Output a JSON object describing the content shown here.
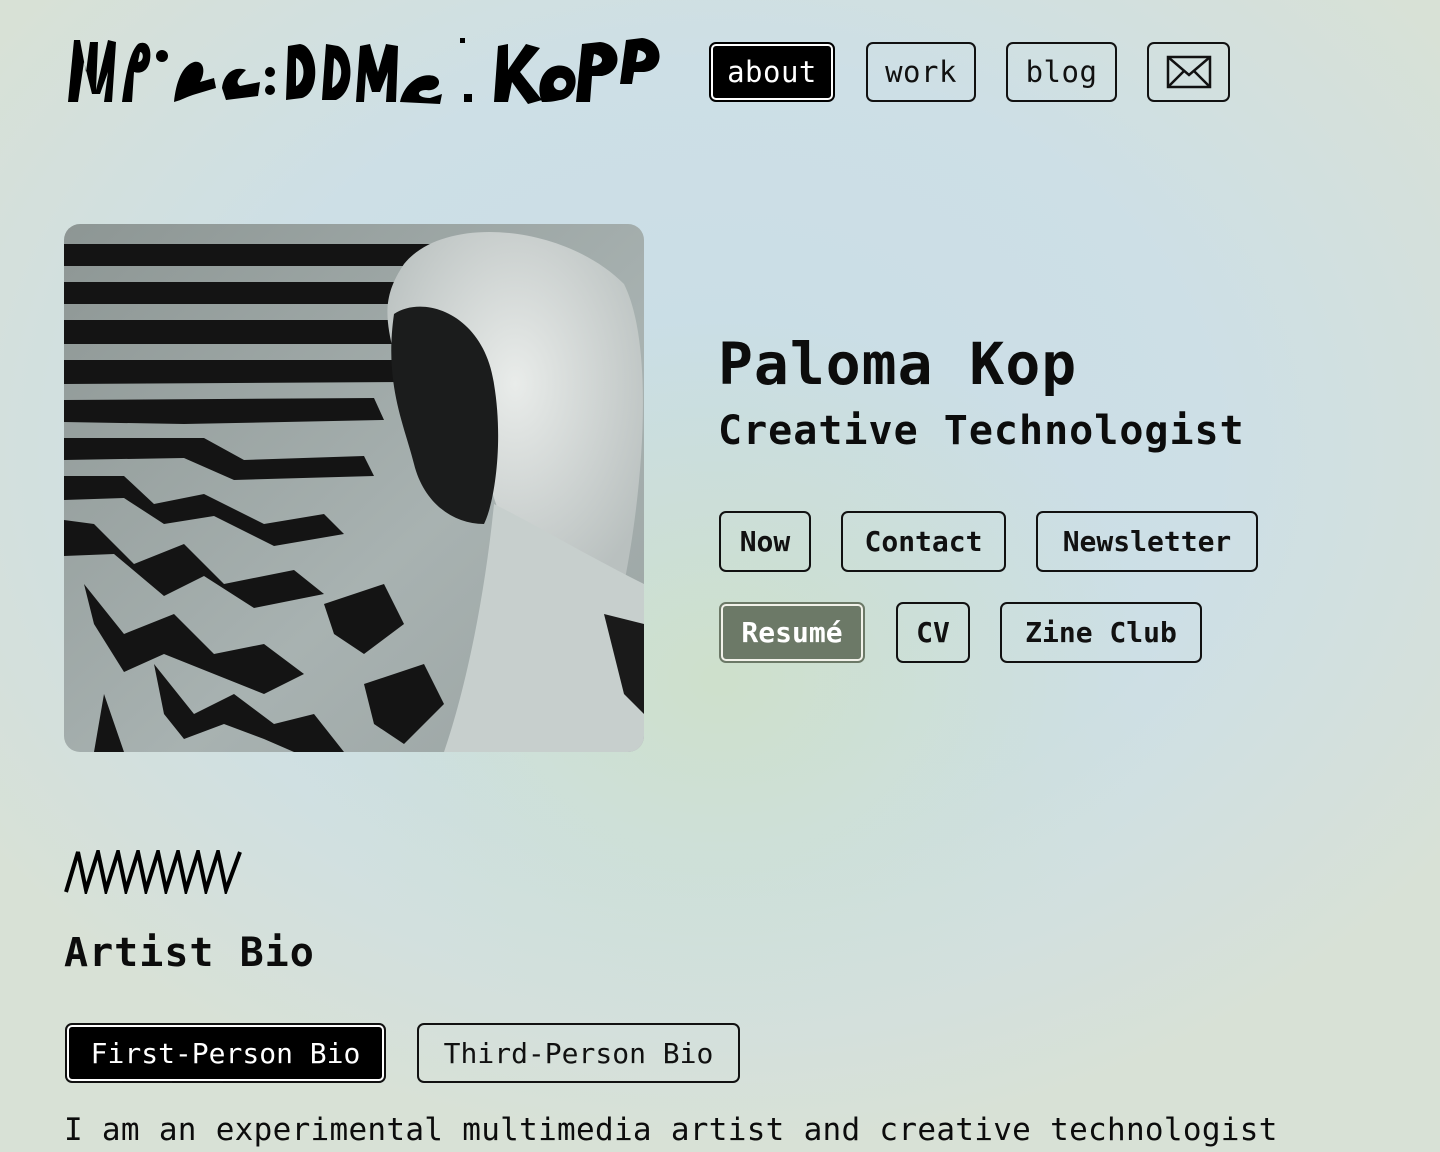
{
  "header": {
    "logo_text": "Paloma Kop",
    "nav": [
      {
        "label": "about",
        "active": true
      },
      {
        "label": "work",
        "active": false
      },
      {
        "label": "blog",
        "active": false
      }
    ],
    "mail_icon": "envelope-icon"
  },
  "profile": {
    "photo_alt": "Paloma Kop",
    "name": "Paloma Kop",
    "role": "Creative Technologist",
    "links_row1": [
      "Now",
      "Contact",
      "Newsletter"
    ],
    "links_row2": [
      "Resumé",
      "CV",
      "Zine Club"
    ]
  },
  "bio": {
    "divider_icon": "zigzag-icon",
    "title": "Artist Bio",
    "tabs": [
      {
        "label": "First-Person Bio",
        "active": true
      },
      {
        "label": "Third-Person Bio",
        "active": false
      }
    ],
    "text": "I am an experimental multimedia artist and creative technologist"
  },
  "colors": {
    "accent_resume": "#6c7967",
    "ink": "#0c0c0c",
    "bg": "#cddfe6"
  }
}
